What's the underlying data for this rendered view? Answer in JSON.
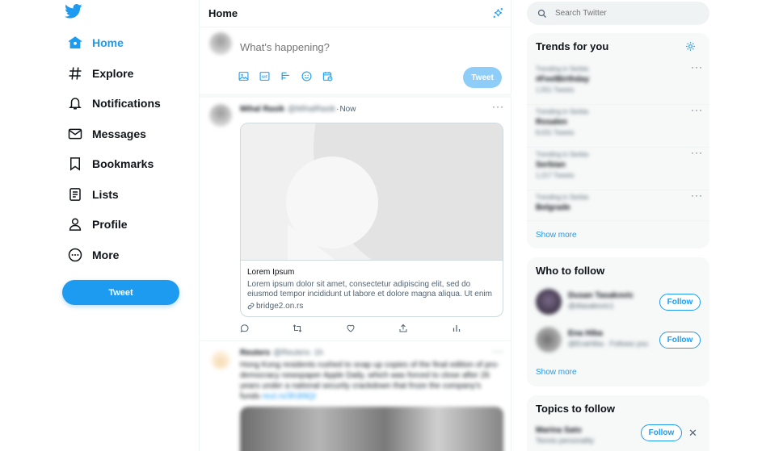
{
  "colors": {
    "accent": "#1d9bf0",
    "text": "#0f1419",
    "muted": "#536471",
    "panel_bg": "#f7f9f9",
    "border": "#eff3f4"
  },
  "nav": {
    "logo_icon": "twitter-bird-icon",
    "items": [
      {
        "label": "Home",
        "icon": "home-icon",
        "active": true
      },
      {
        "label": "Explore",
        "icon": "hashtag-icon"
      },
      {
        "label": "Notifications",
        "icon": "bell-icon"
      },
      {
        "label": "Messages",
        "icon": "envelope-icon"
      },
      {
        "label": "Bookmarks",
        "icon": "bookmark-icon"
      },
      {
        "label": "Lists",
        "icon": "list-icon"
      },
      {
        "label": "Profile",
        "icon": "person-icon"
      },
      {
        "label": "More",
        "icon": "more-circle-icon"
      }
    ],
    "tweet_button": "Tweet"
  },
  "feed": {
    "title": "Home",
    "compose": {
      "placeholder": "What's happening?",
      "tweet_button": "Tweet",
      "tools": [
        "image-icon",
        "gif-icon",
        "poll-icon",
        "emoji-icon",
        "schedule-icon"
      ]
    },
    "tweets": [
      {
        "name": "Mihal Rasik",
        "handle": "@MihalRasik",
        "time": "Now",
        "card": {
          "title": "Lorem Ipsum",
          "description": "Lorem ipsum dolor sit amet, consectetur adipiscing elit, sed do eiusmod tempor incididunt ut labore et dolore magna aliqua. Ut enim ad minim...",
          "link": "bridge2.on.rs"
        },
        "actions": [
          "reply-icon",
          "retweet-icon",
          "like-icon",
          "share-icon",
          "analytics-icon"
        ]
      },
      {
        "name": "Reuters",
        "handle": "@Reuters",
        "time": "1h",
        "text": "Hong Kong residents rushed to snap up copies of the final edition of pro-democracy newspaper Apple Daily, which was forced to close after 26 years under a national security crackdown that froze the company's funds",
        "link": "reut.rs/3h3t9QI"
      }
    ]
  },
  "sidebar": {
    "search_placeholder": "Search Twitter",
    "trends_title": "Trends for you",
    "trends": [
      {
        "context": "Trending in Serbia",
        "name": "#FeelBirthday",
        "count": "1,551 Tweets"
      },
      {
        "context": "Trending in Serbia",
        "name": "Rosalen",
        "count": "8,031 Tweets"
      },
      {
        "context": "Trending in Serbia",
        "name": "Serbian",
        "count": "1,217 Tweets"
      },
      {
        "context": "Trending in Serbia",
        "name": "Belgrade"
      }
    ],
    "trends_show_more": "Show more",
    "who_title": "Who to follow",
    "who": [
      {
        "name": "Dusan Tasakovic",
        "handle": "@dtasakovic1",
        "follow": "Follow"
      },
      {
        "name": "Ena Hiba",
        "handle": "@EnaHiba · Follows you",
        "follow": "Follow"
      }
    ],
    "who_show_more": "Show more",
    "topics_title": "Topics to follow",
    "topics": [
      {
        "name": "Marina Sato",
        "sub": "Tennis personality",
        "follow": "Follow",
        "dismiss": "✕"
      }
    ]
  }
}
